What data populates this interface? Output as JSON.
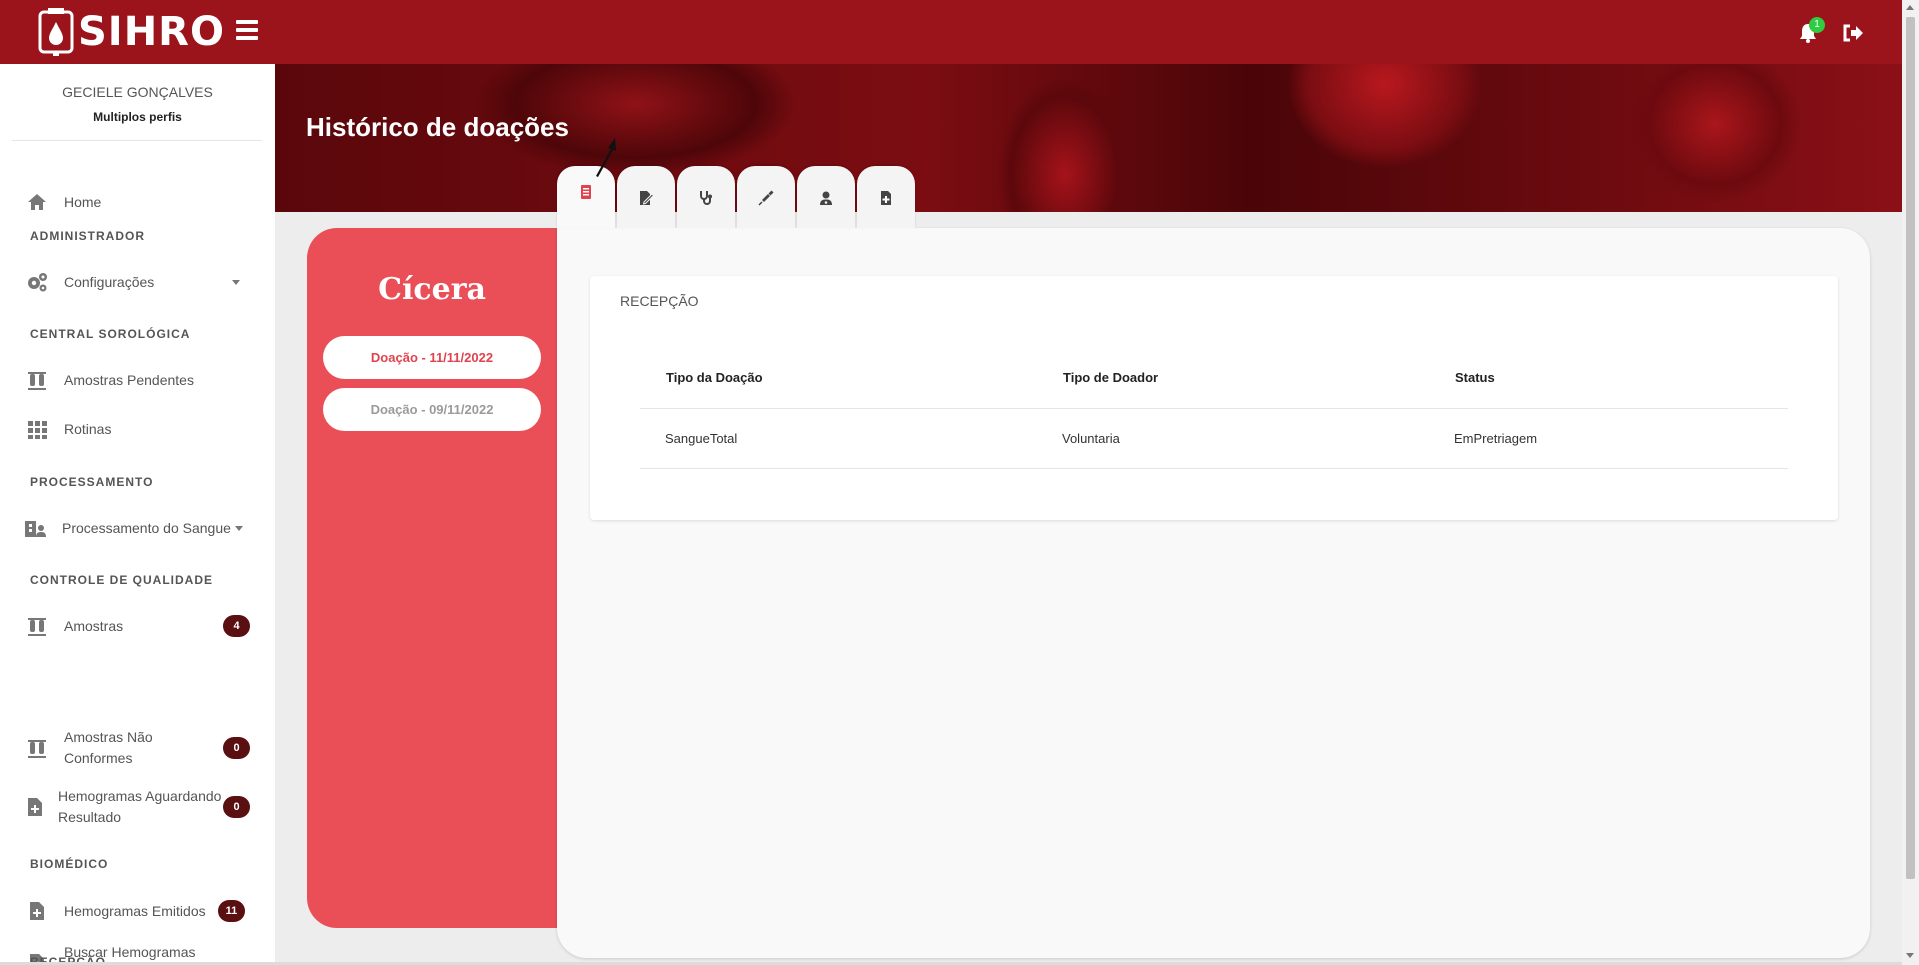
{
  "app": {
    "logo_text": "SIHRO",
    "notification_count": "1"
  },
  "page": {
    "title": "Histórico de doações"
  },
  "user": {
    "name": "GECIELE GONÇALVES",
    "profile": "Multiplos perfis"
  },
  "sidebar": {
    "home": "Home",
    "sections": {
      "admin": "ADMINISTRADOR",
      "sorologica": "CENTRAL SOROLÓGICA",
      "processamento": "PROCESSAMENTO",
      "qualidade": "CONTROLE DE QUALIDADE",
      "biomedico": "BIOMÉDICO",
      "recepcao": "RECEPÇÃO"
    },
    "items": {
      "configuracoes": "Configurações",
      "amostras_pendentes": "Amostras Pendentes",
      "rotinas": "Rotinas",
      "processamento_sangue": "Processamento do Sangue",
      "amostras": "Amostras",
      "amostras_nao_conformes": "Amostras Não Conformes",
      "hemogramas_aguardando": "Hemogramas Aguardando Resultado",
      "hemogramas_emitidos": "Hemogramas Emitidos",
      "buscar_hemogramas": "Buscar Hemogramas Emitidos"
    },
    "badges": {
      "amostras": "4",
      "amostras_nao_conformes": "0",
      "hemogramas_aguardando": "0",
      "hemogramas_emitidos": "11"
    }
  },
  "donor": {
    "name": "Cícera",
    "donations": [
      "Doação - 11/11/2022",
      "Doação - 09/11/2022"
    ]
  },
  "tabs": [
    "file-medical-icon",
    "file-signature-icon",
    "stethoscope-icon",
    "syringe-icon",
    "user-doctor-icon",
    "file-plus-icon"
  ],
  "reception": {
    "title": "RECEPÇÃO",
    "headers": [
      "Tipo da Doação",
      "Tipo de Doador",
      "Status"
    ],
    "row": [
      "SangueTotal",
      "Voluntaria",
      "EmPretriagem"
    ]
  },
  "colors": {
    "brand": "#9b141b",
    "accent": "#ea4f57",
    "badge": "#5a0f10"
  }
}
